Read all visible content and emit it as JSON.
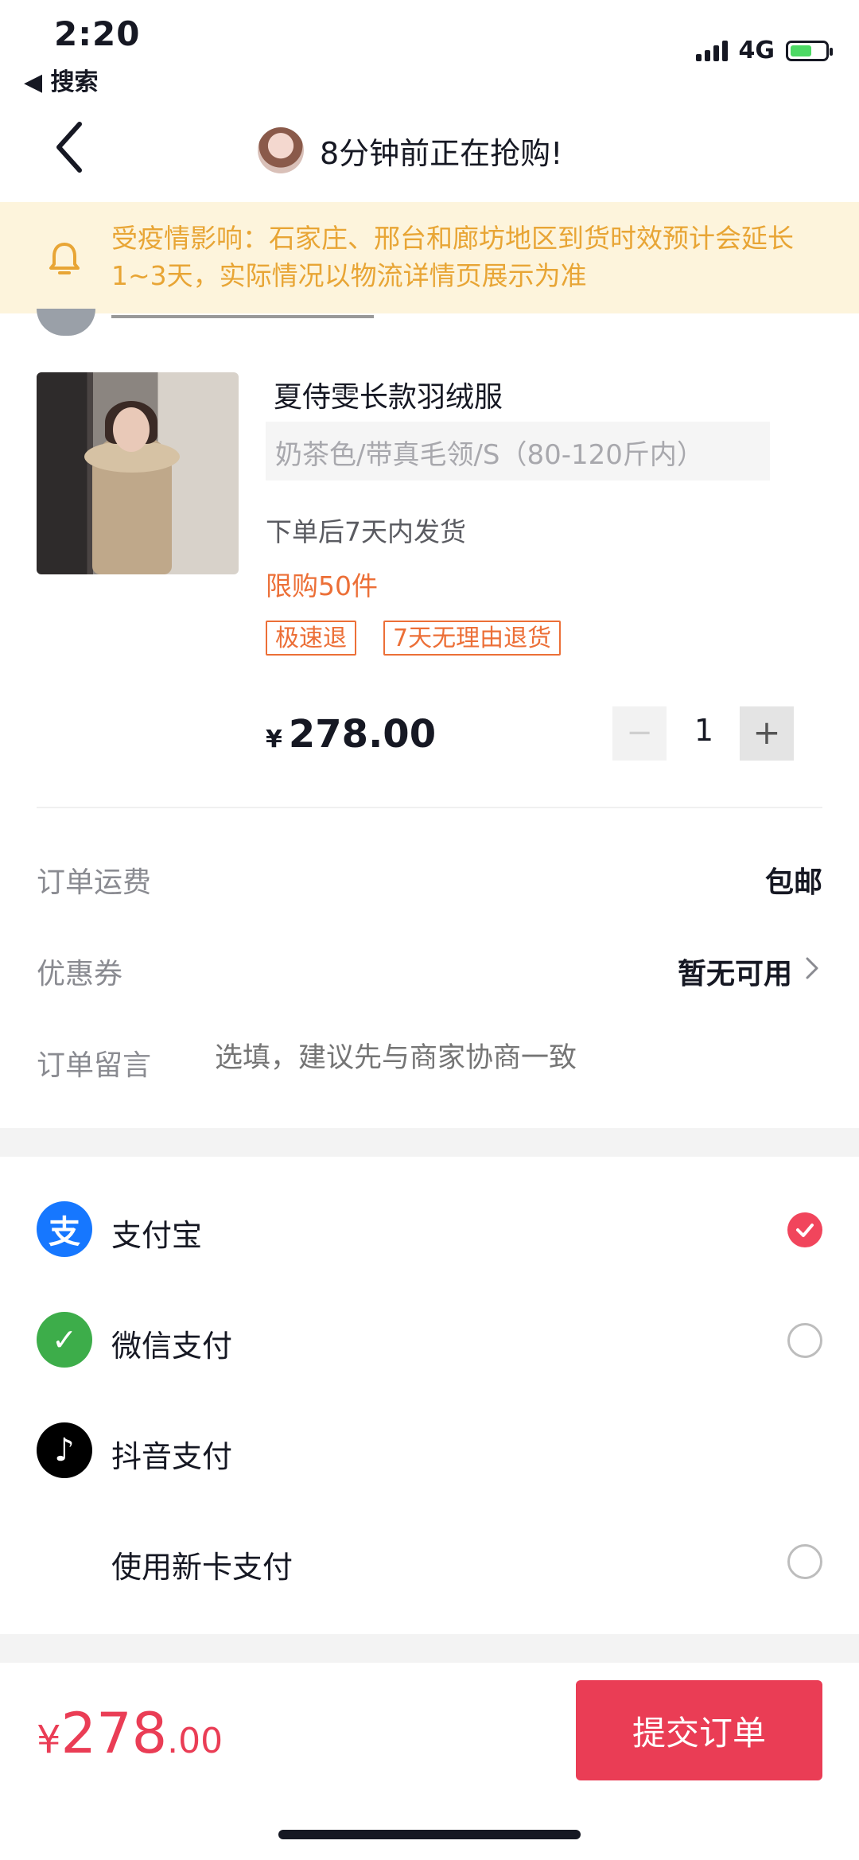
{
  "status_bar": {
    "time": "2:20",
    "back_app": "◀ 搜索",
    "network": "4G"
  },
  "header": {
    "title": "8分钟前正在抢购!"
  },
  "notice": {
    "text": "受疫情影响：石家庄、邢台和廊坊地区到货时效预计会延长1~3天，实际情况以物流详情页展示为准",
    "color": "#e8a535"
  },
  "product": {
    "title": "夏侍雯长款羽绒服",
    "sku": "奶茶色/带真毛领/S（80-120斤内）",
    "shipping_note": "下单后7天内发货",
    "purchase_limit": "限购50件",
    "tags": [
      "极速退",
      "7天无理由退货"
    ],
    "currency": "¥",
    "price": "278.00",
    "quantity": "1",
    "minus_label": "−",
    "plus_label": "+"
  },
  "order": {
    "shipping_label": "订单运费",
    "shipping_value": "包邮",
    "coupon_label": "优惠券",
    "coupon_value": "暂无可用",
    "message_label": "订单留言",
    "message_placeholder": "选填，建议先与商家协商一致"
  },
  "payment": {
    "methods": [
      {
        "label": "支付宝",
        "icon": "alipay-icon",
        "icon_glyph": "支",
        "color": "#1677ff",
        "selected": true
      },
      {
        "label": "微信支付",
        "icon": "wechat-pay-icon",
        "icon_glyph": "✓",
        "color": "#3dad4a",
        "selected": false
      },
      {
        "label": "抖音支付",
        "icon": "douyin-pay-icon",
        "icon_glyph": "♪",
        "color": "#000000",
        "selected": false
      },
      {
        "label": "使用新卡支付",
        "icon": null,
        "selected": false
      }
    ]
  },
  "footer": {
    "currency": "¥",
    "total_int": "278",
    "total_dec": ".00",
    "submit_label": "提交订单"
  },
  "colors": {
    "accent_red": "#ea3d55",
    "tag_orange": "#ec6f37",
    "notice_bg": "#fdf4dc"
  }
}
